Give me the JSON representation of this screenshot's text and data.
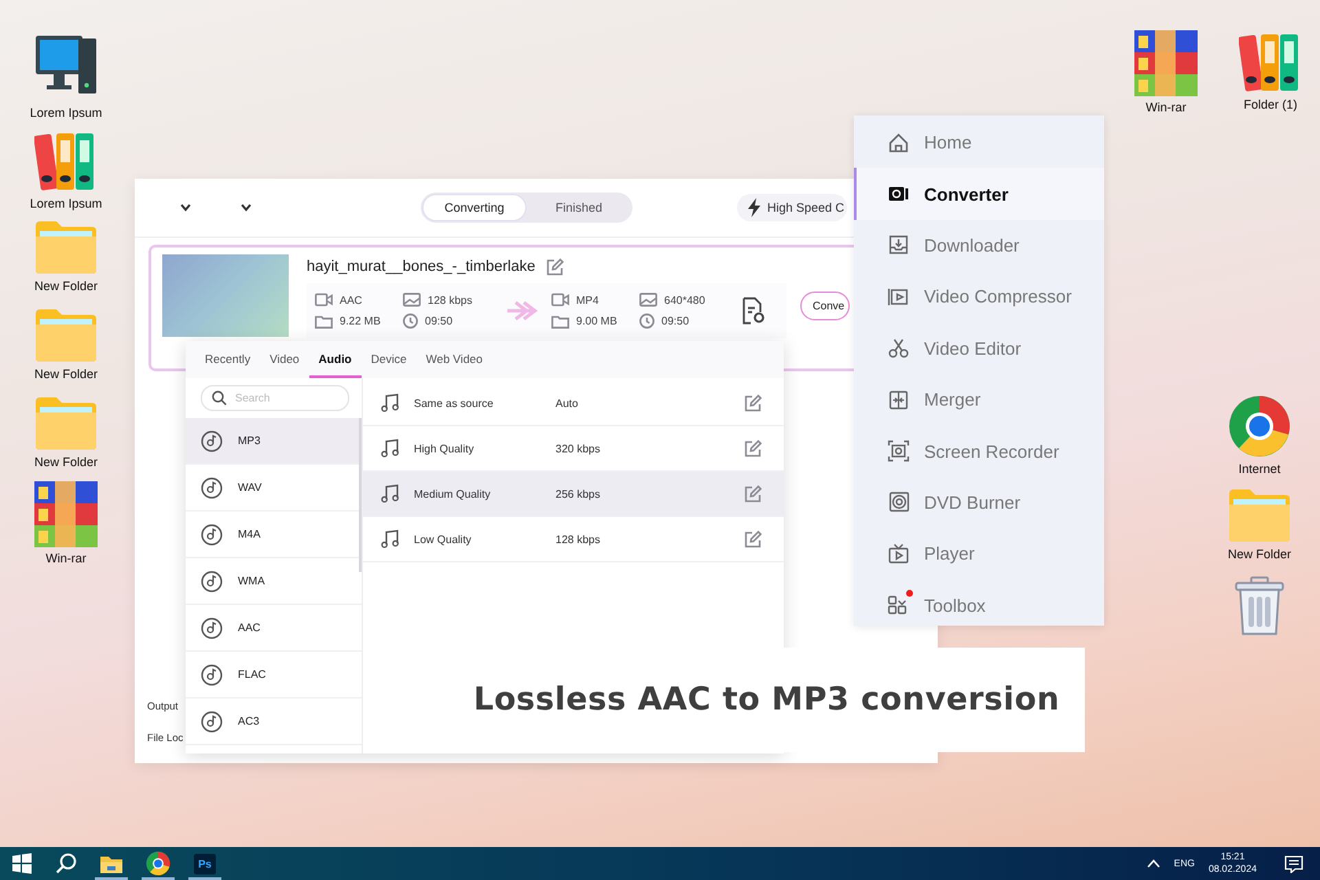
{
  "desktop_icons_left": [
    {
      "kind": "computer",
      "label": "Lorem Ipsum"
    },
    {
      "kind": "binders",
      "label": "Lorem Ipsum"
    },
    {
      "kind": "folder",
      "label": "New Folder"
    },
    {
      "kind": "folder",
      "label": "New Folder"
    },
    {
      "kind": "folder",
      "label": "New Folder"
    },
    {
      "kind": "archive",
      "label": "Win-rar"
    }
  ],
  "desktop_icons_top_right": [
    {
      "kind": "archive",
      "label": "Win-rar"
    },
    {
      "kind": "binders",
      "label": "Folder (1)"
    }
  ],
  "desktop_icons_right": [
    {
      "kind": "browser",
      "label": "Internet"
    },
    {
      "kind": "folder",
      "label": "New Folder"
    },
    {
      "kind": "trash"
    }
  ],
  "converter_window": {
    "view_tabs": [
      {
        "label": "Converting",
        "selected": true
      },
      {
        "label": "Finished",
        "selected": false
      }
    ],
    "high_speed": "High Speed C",
    "file": {
      "name": "hayit_murat__bones_-_timberlake",
      "source": {
        "format": "AAC",
        "bitrate": "128 kbps",
        "size": "9.22 MB",
        "duration": "09:50"
      },
      "target": {
        "format": "MP4",
        "resolution": "640*480",
        "size": "9.00 MB",
        "duration": "09:50"
      },
      "convert_button": "Conve"
    },
    "output_label": "Output",
    "file_location_label": "File Loc"
  },
  "format_popup": {
    "tabs": [
      {
        "label": "Recently",
        "selected": false
      },
      {
        "label": "Video",
        "selected": false
      },
      {
        "label": "Audio",
        "selected": true
      },
      {
        "label": "Device",
        "selected": false
      },
      {
        "label": "Web Video",
        "selected": false
      }
    ],
    "search": {
      "placeholder": "Search"
    },
    "formats": [
      {
        "label": "MP3",
        "selected": true
      },
      {
        "label": "WAV",
        "selected": false
      },
      {
        "label": "M4A",
        "selected": false
      },
      {
        "label": "WMA",
        "selected": false
      },
      {
        "label": "AAC",
        "selected": false
      },
      {
        "label": "FLAC",
        "selected": false
      },
      {
        "label": "AC3",
        "selected": false
      }
    ],
    "presets": [
      {
        "name": "Same as source",
        "bitrate": "Auto",
        "selected": false
      },
      {
        "name": "High Quality",
        "bitrate": "320 kbps",
        "selected": false
      },
      {
        "name": "Medium Quality",
        "bitrate": "256 kbps",
        "selected": true
      },
      {
        "name": "Low Quality",
        "bitrate": "128 kbps",
        "selected": false
      }
    ]
  },
  "side_menu": {
    "items": [
      {
        "kind": "home",
        "label": "Home",
        "selected": false,
        "badge": false
      },
      {
        "kind": "converter",
        "label": "Converter",
        "selected": true,
        "badge": false
      },
      {
        "kind": "downloader",
        "label": "Downloader",
        "selected": false,
        "badge": false
      },
      {
        "kind": "compressor",
        "label": "Video Compressor",
        "selected": false,
        "badge": false
      },
      {
        "kind": "editor",
        "label": "Video Editor",
        "selected": false,
        "badge": false
      },
      {
        "kind": "merger",
        "label": "Merger",
        "selected": false,
        "badge": false
      },
      {
        "kind": "recorder",
        "label": "Screen Recorder",
        "selected": false,
        "badge": false
      },
      {
        "kind": "dvd",
        "label": "DVD Burner",
        "selected": false,
        "badge": false
      },
      {
        "kind": "player",
        "label": "Player",
        "selected": false,
        "badge": false
      },
      {
        "kind": "toolbox",
        "label": "Toolbox",
        "selected": false,
        "badge": true
      }
    ]
  },
  "caption": "Lossless AAC to MP3 conversion",
  "taskbar": {
    "apps": [
      {
        "kind": "start",
        "open": false
      },
      {
        "kind": "search",
        "open": false
      },
      {
        "kind": "explorer",
        "open": true
      },
      {
        "kind": "browser",
        "open": true
      },
      {
        "kind": "photoshop",
        "label": "Ps",
        "open": true
      }
    ],
    "language": "ENG",
    "time": "15:21",
    "date": "08.02.2024"
  }
}
